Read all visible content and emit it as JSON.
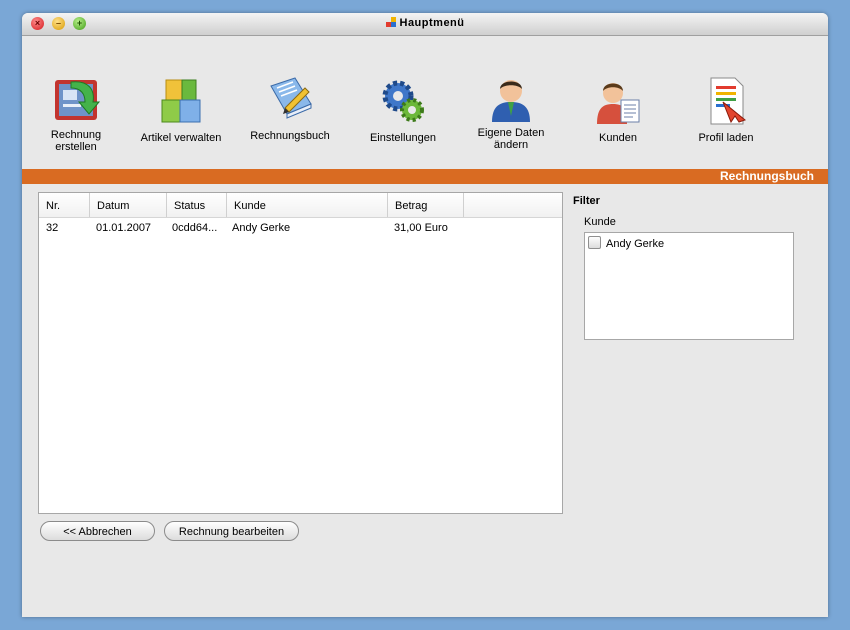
{
  "window": {
    "title": "Hauptmenü"
  },
  "toolbar": {
    "items": [
      {
        "label_line1": "Rechnung",
        "label_line2": "erstellen",
        "icon": "invoice-create-icon"
      },
      {
        "label_line1": "Artikel verwalten",
        "label_line2": "",
        "icon": "boxes-icon"
      },
      {
        "label_line1": "Rechnungsbuch",
        "label_line2": "",
        "icon": "book-pen-icon"
      },
      {
        "label_line1": "Einstellungen",
        "label_line2": "",
        "icon": "gears-icon"
      },
      {
        "label_line1": "Eigene Daten",
        "label_line2": "ändern",
        "icon": "user-icon"
      },
      {
        "label_line1": "Kunden",
        "label_line2": "",
        "icon": "customer-card-icon"
      },
      {
        "label_line1": "Profil laden",
        "label_line2": "",
        "icon": "profile-load-icon"
      }
    ]
  },
  "section": {
    "title": "Rechnungsbuch",
    "accent": "#d96b22"
  },
  "table": {
    "columns": [
      "Nr.",
      "Datum",
      "Status",
      "Kunde",
      "Betrag"
    ],
    "rows": [
      [
        "32",
        "01.01.2007",
        "0cdd64...",
        "Andy Gerke",
        "31,00 Euro"
      ]
    ]
  },
  "filter": {
    "title": "Filter",
    "kunde_label": "Kunde",
    "options": [
      {
        "label": "Andy Gerke",
        "checked": false
      }
    ]
  },
  "buttons": {
    "cancel": "<< Abbrechen",
    "edit": "Rechnung bearbeiten"
  }
}
